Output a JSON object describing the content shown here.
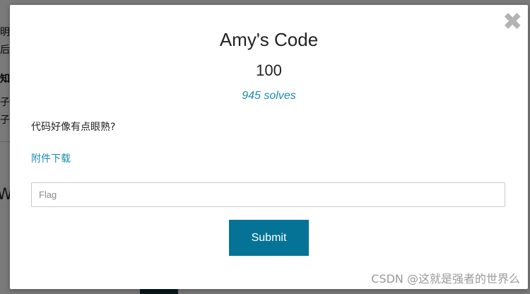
{
  "background": {
    "lines": [
      "明",
      "后",
      "知",
      "子",
      "子"
    ],
    "large_letter": "W"
  },
  "modal": {
    "close_symbol": "✖",
    "title": "Amy's Code",
    "points": "100",
    "solves": "945 solves",
    "description": "代码好像有点眼熟?",
    "attachment_label": "附件下载",
    "flag_placeholder": "Flag",
    "submit_label": "Submit"
  },
  "watermark": "CSDN @这就是强者的世界么",
  "colors": {
    "accent": "#047396",
    "link": "#1b8cb0",
    "close": "#b3b3b3"
  }
}
